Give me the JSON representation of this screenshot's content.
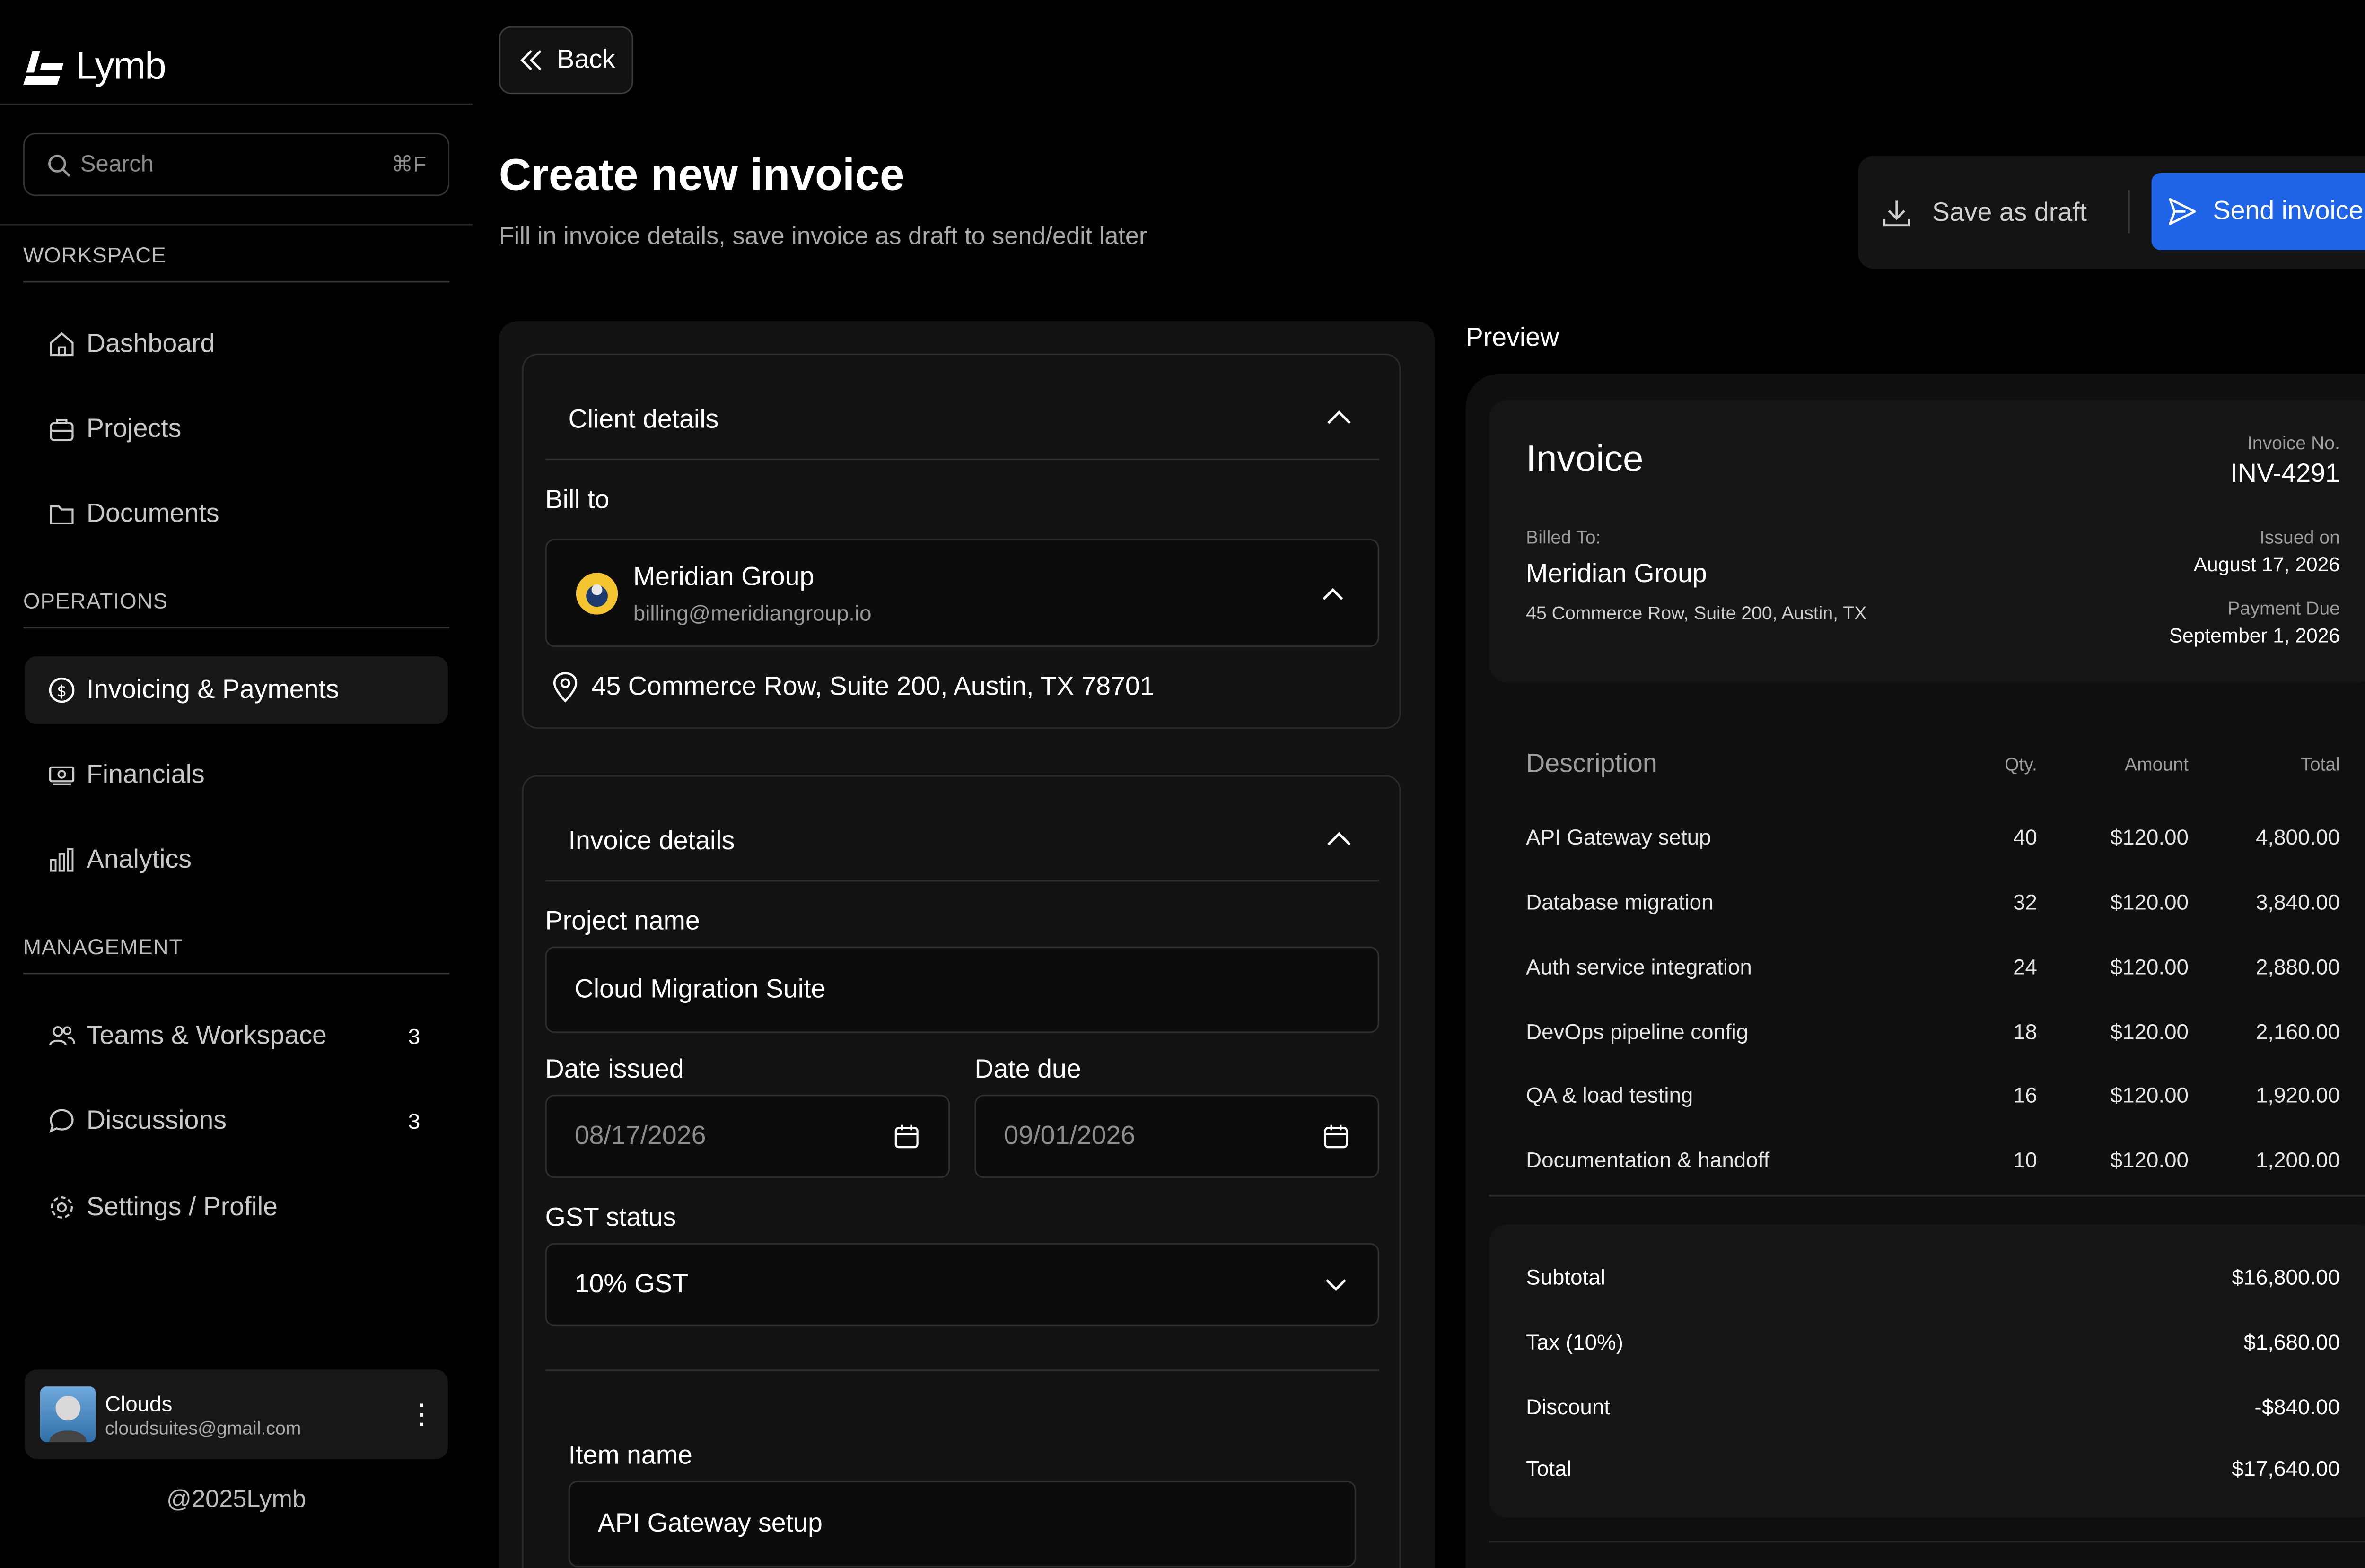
{
  "app": {
    "name": "Lymb",
    "copyright": "@2025Lymb"
  },
  "search": {
    "placeholder": "Search",
    "shortcut": "⌘F"
  },
  "sections": {
    "workspace": "WORKSPACE",
    "operations": "OPERATIONS",
    "management": "MANAGEMENT"
  },
  "nav": {
    "dashboard": "Dashboard",
    "projects": "Projects",
    "documents": "Documents",
    "invoicing": "Invoicing & Payments",
    "financials": "Financials",
    "analytics": "Analytics",
    "teams": "Teams & Workspace",
    "teams_badge": "3",
    "discussions": "Discussions",
    "discussions_badge": "3",
    "settings": "Settings / Profile"
  },
  "user": {
    "name": "Clouds",
    "email": "cloudsuites@gmail.com"
  },
  "header": {
    "back": "Back",
    "title": "Create new invoice",
    "subtitle": "Fill in invoice details, save invoice as draft to send/edit later",
    "save_draft": "Save as draft",
    "send": "Send invoice"
  },
  "client_details": {
    "heading": "Client details",
    "bill_to_label": "Bill to",
    "client_name": "Meridian Group",
    "client_email": "billing@meridiangroup.io",
    "address": "45 Commerce Row, Suite 200, Austin, TX 78701"
  },
  "invoice_details": {
    "heading": "Invoice details",
    "project_label": "Project name",
    "project_value": "Cloud Migration Suite",
    "date_issued_label": "Date issued",
    "date_issued_value": "08/17/2026",
    "date_due_label": "Date due",
    "date_due_value": "09/01/2026",
    "gst_label": "GST status",
    "gst_value": "10% GST",
    "item_label": "Item name",
    "item_value": "API Gateway setup"
  },
  "preview": {
    "label": "Preview",
    "title": "Invoice",
    "invoice_no_label": "Invoice No.",
    "invoice_no": "INV-4291",
    "billed_to_label": "Billed To:",
    "billed_name": "Meridian Group",
    "billed_address": "45 Commerce Row, Suite 200, Austin, TX",
    "issued_label": "Issued on",
    "issued_value": "August 17, 2026",
    "due_label": "Payment Due",
    "due_value": "September 1, 2026",
    "columns": {
      "description": "Description",
      "qty": "Qty.",
      "amount": "Amount",
      "total": "Total"
    },
    "items": [
      {
        "desc": "API Gateway setup",
        "qty": "40",
        "amount": "$120.00",
        "total": "4,800.00"
      },
      {
        "desc": "Database migration",
        "qty": "32",
        "amount": "$120.00",
        "total": "3,840.00"
      },
      {
        "desc": "Auth service integration",
        "qty": "24",
        "amount": "$120.00",
        "total": "2,880.00"
      },
      {
        "desc": "DevOps pipeline config",
        "qty": "18",
        "amount": "$120.00",
        "total": "2,160.00"
      },
      {
        "desc": "QA & load testing",
        "qty": "16",
        "amount": "$120.00",
        "total": "1,920.00"
      },
      {
        "desc": "Documentation & handoff",
        "qty": "10",
        "amount": "$120.00",
        "total": "1,200.00"
      }
    ],
    "totals": {
      "subtotal_label": "Subtotal",
      "subtotal": "$16,800.00",
      "tax_label": "Tax (10%)",
      "tax": "$1,680.00",
      "discount_label": "Discount",
      "discount": "-$840.00",
      "total_label": "Total",
      "total": "$17,640.00"
    }
  },
  "colors": {
    "accent": "#1f63e6",
    "panel": "#121212",
    "background": "#000000"
  }
}
